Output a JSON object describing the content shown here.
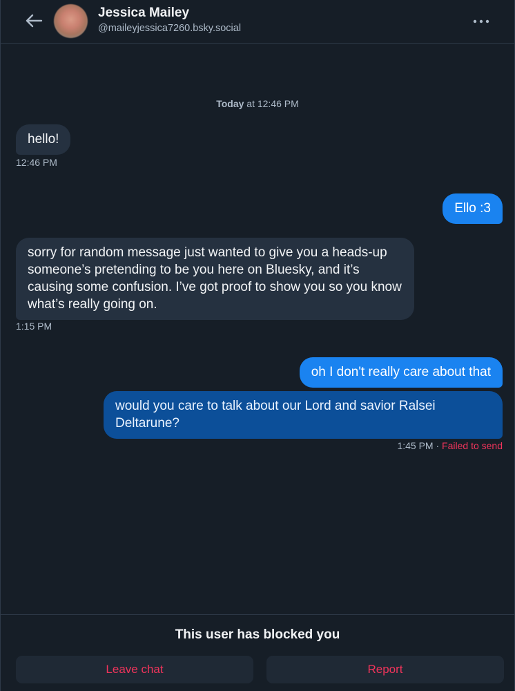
{
  "header": {
    "name": "Jessica Mailey",
    "handle": "@maileyjessica7260.bsky.social"
  },
  "date_separator": {
    "day": "Today",
    "rest": " at 12:46 PM"
  },
  "messages": [
    {
      "direction": "in",
      "text": "hello!",
      "time": "12:46 PM"
    },
    {
      "direction": "out",
      "text": "Ello :3"
    },
    {
      "direction": "in",
      "text": "sorry for random message just wanted to give you a heads-up someone’s pretending to be you here on Bluesky, and it’s causing some confusion. I’ve got proof to show you so you know what’s really going on.",
      "time": "1:15 PM"
    },
    {
      "direction": "out",
      "text": "oh I don't really care about that"
    },
    {
      "direction": "out",
      "text": "would you care to talk about our Lord and savior Ralsei Deltarune?",
      "time": "1:45 PM",
      "separator": " · ",
      "status": "Failed to send"
    }
  ],
  "footer": {
    "blocked_text": "This user has blocked you",
    "leave_label": "Leave chat",
    "report_label": "Report"
  },
  "colors": {
    "background": "#161e27",
    "incoming_bubble": "#253140",
    "outgoing_bubble": "#1a83f0",
    "failed_bubble": "#0c4f99",
    "danger": "#f0345b"
  },
  "icons": {
    "back": "arrow-left-icon",
    "more": "more-horizontal-icon",
    "avatar": "avatar"
  }
}
